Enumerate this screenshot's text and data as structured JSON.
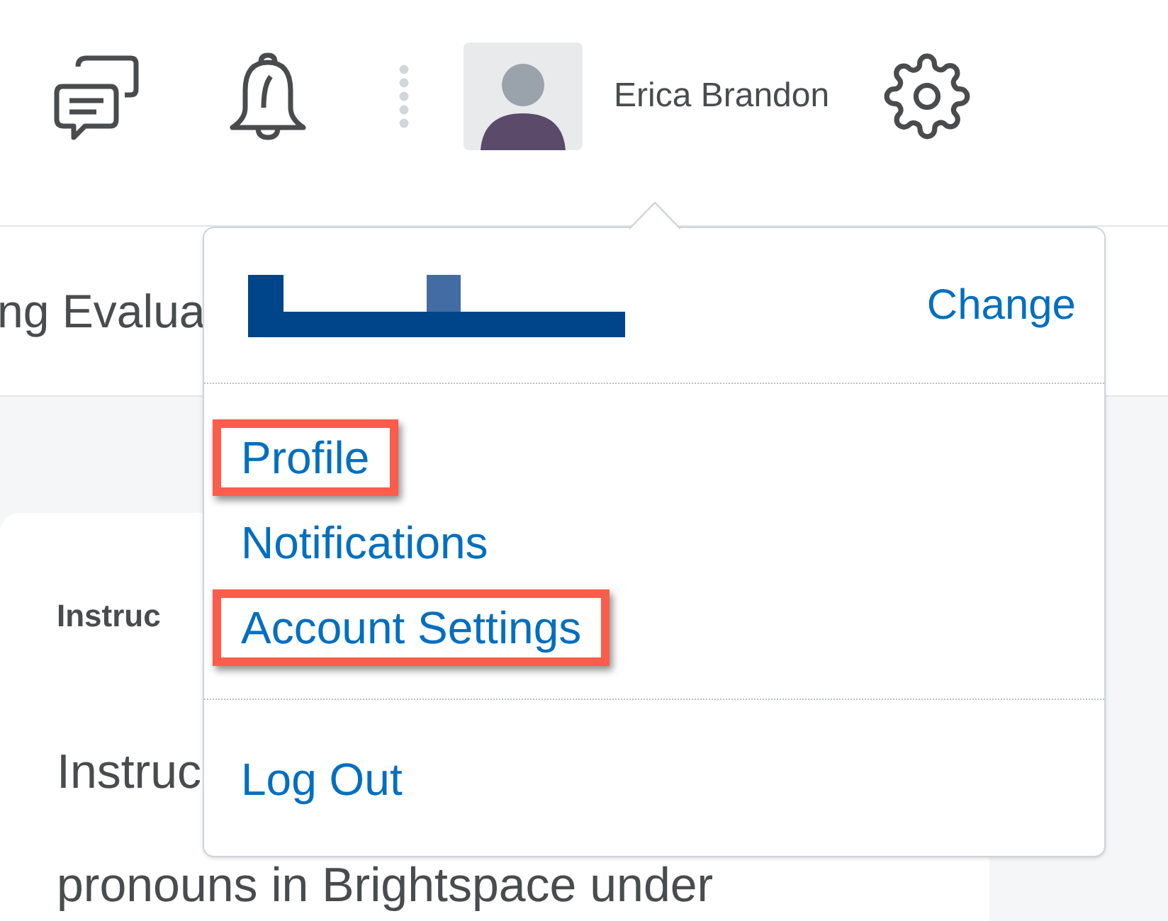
{
  "header": {
    "user_name": "Erica Brandon"
  },
  "page_title": "ng Evalua",
  "card": {
    "heading": "Instruc",
    "lines": [
      "Instruc",
      "pronouns in Brightspace under"
    ]
  },
  "dropdown": {
    "change_link": "Change",
    "sections": [
      {
        "items": [
          {
            "label": "Profile",
            "highlighted": true
          },
          {
            "label": "Notifications",
            "highlighted": false
          },
          {
            "label": "Account Settings",
            "highlighted": true
          }
        ]
      },
      {
        "items": [
          {
            "label": "Log Out",
            "highlighted": false
          }
        ]
      }
    ]
  }
}
